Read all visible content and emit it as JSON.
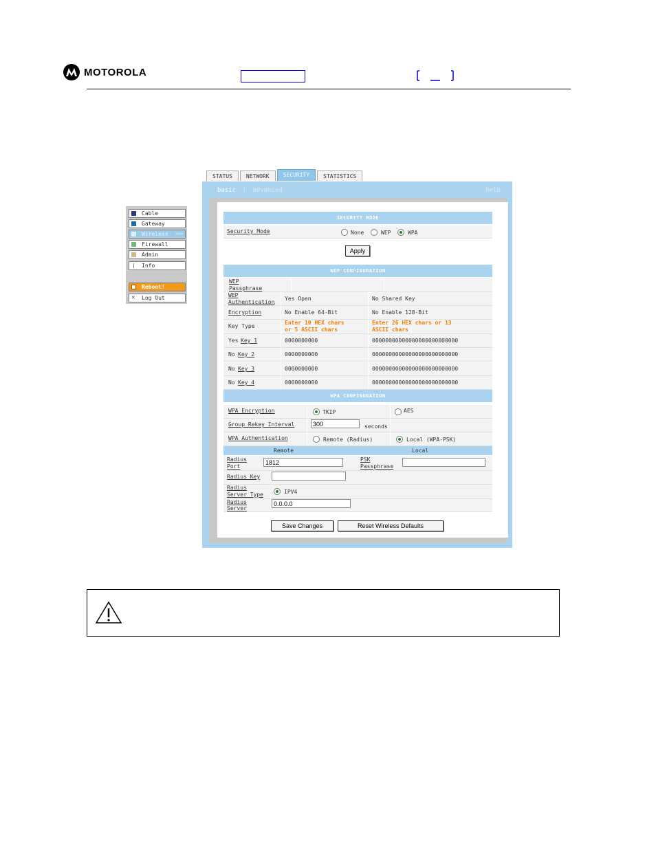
{
  "header": {
    "brand": "MOTOROLA"
  },
  "sidenav": {
    "items": [
      {
        "label": "Cable",
        "color": "#2a3a7a"
      },
      {
        "label": "Gateway",
        "color": "#1a6aa0"
      },
      {
        "label": "Wireless",
        "color": "#9ccbea",
        "suffix": ">>>"
      },
      {
        "label": "Firewall",
        "color": "#6dbb75"
      },
      {
        "label": "Admin",
        "color": "#c9b88a"
      },
      {
        "label": "Info",
        "color": "#bbbbbb"
      }
    ],
    "reboot": "Reboot!",
    "logout": "Log Out"
  },
  "tabs": [
    "STATUS",
    "NETWORK",
    "SECURITY",
    "STATISTICS"
  ],
  "subnav": {
    "basic": "basic",
    "sep": "|",
    "advanced": "advanced",
    "help": "help"
  },
  "security_mode": {
    "header": "SECURITY MODE",
    "label": "Security Mode",
    "options": [
      "None",
      "WEP",
      "WPA"
    ],
    "selected": "WPA",
    "apply": "Apply"
  },
  "wep": {
    "header": "WEP CONFIGURATION",
    "passphrase_label": [
      "WEP",
      "Passphrase"
    ],
    "auth_label": [
      "WEP",
      "Authentication"
    ],
    "auth_opt1": "Yes Open",
    "auth_opt2": "No Shared Key",
    "enc_label": "Encryption",
    "enc_opt1": "No Enable 64-Bit",
    "enc_opt2": "No Enable 128-Bit",
    "keytype_label": "Key Type",
    "keytype_opt1": [
      "Enter 10 HEX chars",
      "or 5 ASCII chars"
    ],
    "keytype_opt2": [
      "Enter 26 HEX chars or 13",
      "ASCII chars"
    ],
    "keys": [
      {
        "prefix": "Yes",
        "label": "Key 1",
        "v64": "0000000000",
        "v128": "00000000000000000000000000"
      },
      {
        "prefix": "No",
        "label": "Key 2",
        "v64": "0000000000",
        "v128": "00000000000000000000000000"
      },
      {
        "prefix": "No",
        "label": "Key 3",
        "v64": "0000000000",
        "v128": "00000000000000000000000000"
      },
      {
        "prefix": "No",
        "label": "Key 4",
        "v64": "0000000000",
        "v128": "00000000000000000000000000"
      }
    ]
  },
  "wpa": {
    "header": "WPA CONFIGURATION",
    "enc_label": "WPA Encryption",
    "enc_opt1": "TKIP",
    "enc_opt2": "AES",
    "rekey_label": "Group Rekey Interval",
    "rekey_value": "300",
    "rekey_unit": "seconds",
    "auth_label": "WPA Authentication",
    "auth_opt1": "Remote (Radius)",
    "auth_opt2": "Local (WPA-PSK)",
    "col_remote": "Remote",
    "col_local": "Local",
    "radius_port_label": [
      "Radius",
      "Port"
    ],
    "radius_port_value": "1812",
    "psk_label": [
      "PSK",
      "Passphrase"
    ],
    "psk_value": "",
    "radius_key_label": "Radius Key",
    "radius_key_value": "",
    "server_type_label": [
      "Radius",
      "Server Type"
    ],
    "server_type_value": "IPV4",
    "server_label": [
      "Radius",
      "Server"
    ],
    "server_value": "0.0.0.0"
  },
  "buttons": {
    "save": "Save Changes",
    "reset": "Reset Wireless Defaults"
  }
}
